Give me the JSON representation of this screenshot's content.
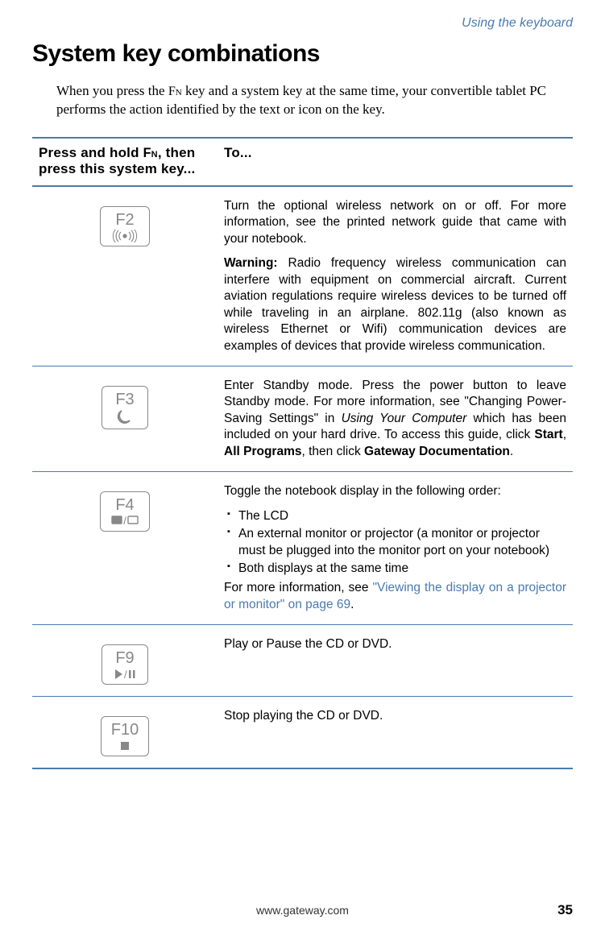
{
  "header": {
    "context": "Using the keyboard"
  },
  "heading": "System key combinations",
  "intro": {
    "pre": "When you press the ",
    "fn": "Fn",
    "post": " key and a system key at the same time, your convertible tablet PC performs the action identified by the text or icon on the key."
  },
  "table": {
    "col1_pre": "Press and hold ",
    "col1_fn": "Fn",
    "col1_post": ", then press this system key...",
    "col2": "To...",
    "rows": {
      "f2": {
        "label": "F2",
        "p1": "Turn the optional wireless network on or off. For more information, see the printed network guide that came with your notebook.",
        "warn_label": "Warning:",
        "warn_text": " Radio frequency wireless communication can interfere with equipment on commercial aircraft. Current aviation regulations require wireless devices to be turned off while traveling in an airplane. 802.11g (also known as wireless Ethernet or Wifi) communication devices are examples of devices that provide wireless communication."
      },
      "f3": {
        "label": "F3",
        "p1_a": "Enter Standby mode. Press the power button to leave Standby mode. For more information, see \"Changing Power-Saving Settings\" in ",
        "p1_italic": "Using Your Computer",
        "p1_b": " which has been included on your hard drive. To access this guide, click ",
        "b1": "Start",
        "comma": ", ",
        "b2": "All Programs",
        "then": ", then click ",
        "b3": "Gateway Documentation",
        "dot": "."
      },
      "f4": {
        "label": "F4",
        "lead": "Toggle the notebook display in the following order:",
        "li1": "The LCD",
        "li2": "An external monitor or projector (a monitor or projector must be plugged into the monitor port on your notebook)",
        "li3": "Both displays at the same time",
        "tail_a": "For more information, see ",
        "tail_link": "\"Viewing the display on a projector or monitor\" on page 69",
        "tail_b": "."
      },
      "f9": {
        "label": "F9",
        "text": "Play or Pause the CD or DVD."
      },
      "f10": {
        "label": "F10",
        "text": "Stop playing the CD or DVD."
      }
    }
  },
  "footer": {
    "url": "www.gateway.com",
    "page": "35"
  }
}
